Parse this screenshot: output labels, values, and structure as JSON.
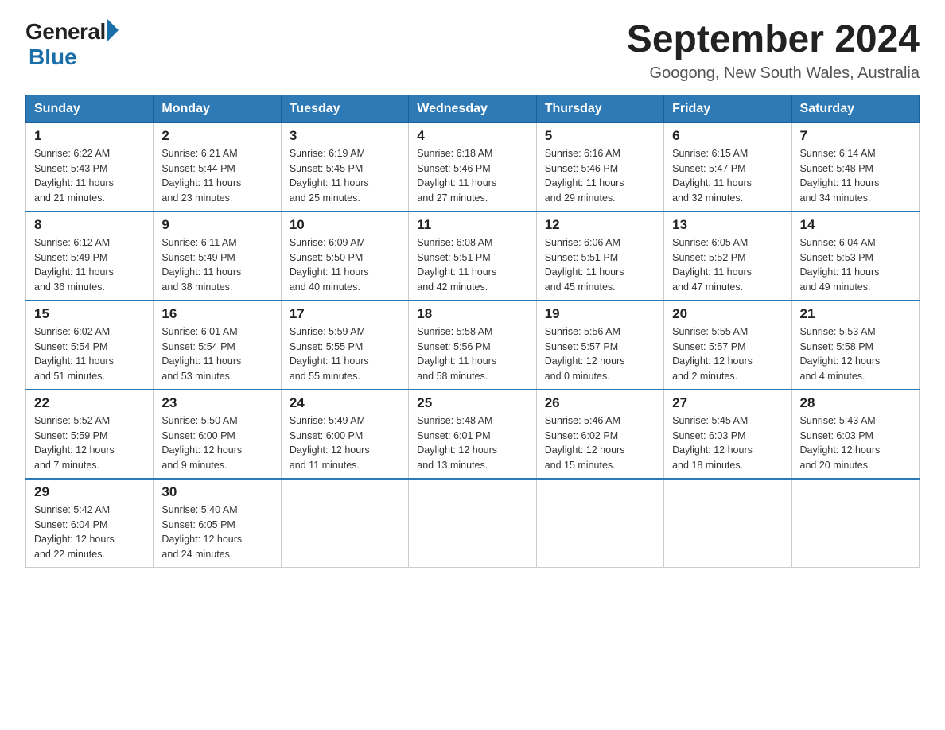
{
  "logo": {
    "general": "General",
    "blue": "Blue"
  },
  "title": "September 2024",
  "subtitle": "Googong, New South Wales, Australia",
  "days_of_week": [
    "Sunday",
    "Monday",
    "Tuesday",
    "Wednesday",
    "Thursday",
    "Friday",
    "Saturday"
  ],
  "weeks": [
    [
      {
        "day": "1",
        "sunrise": "6:22 AM",
        "sunset": "5:43 PM",
        "daylight": "11 hours and 21 minutes."
      },
      {
        "day": "2",
        "sunrise": "6:21 AM",
        "sunset": "5:44 PM",
        "daylight": "11 hours and 23 minutes."
      },
      {
        "day": "3",
        "sunrise": "6:19 AM",
        "sunset": "5:45 PM",
        "daylight": "11 hours and 25 minutes."
      },
      {
        "day": "4",
        "sunrise": "6:18 AM",
        "sunset": "5:46 PM",
        "daylight": "11 hours and 27 minutes."
      },
      {
        "day": "5",
        "sunrise": "6:16 AM",
        "sunset": "5:46 PM",
        "daylight": "11 hours and 29 minutes."
      },
      {
        "day": "6",
        "sunrise": "6:15 AM",
        "sunset": "5:47 PM",
        "daylight": "11 hours and 32 minutes."
      },
      {
        "day": "7",
        "sunrise": "6:14 AM",
        "sunset": "5:48 PM",
        "daylight": "11 hours and 34 minutes."
      }
    ],
    [
      {
        "day": "8",
        "sunrise": "6:12 AM",
        "sunset": "5:49 PM",
        "daylight": "11 hours and 36 minutes."
      },
      {
        "day": "9",
        "sunrise": "6:11 AM",
        "sunset": "5:49 PM",
        "daylight": "11 hours and 38 minutes."
      },
      {
        "day": "10",
        "sunrise": "6:09 AM",
        "sunset": "5:50 PM",
        "daylight": "11 hours and 40 minutes."
      },
      {
        "day": "11",
        "sunrise": "6:08 AM",
        "sunset": "5:51 PM",
        "daylight": "11 hours and 42 minutes."
      },
      {
        "day": "12",
        "sunrise": "6:06 AM",
        "sunset": "5:51 PM",
        "daylight": "11 hours and 45 minutes."
      },
      {
        "day": "13",
        "sunrise": "6:05 AM",
        "sunset": "5:52 PM",
        "daylight": "11 hours and 47 minutes."
      },
      {
        "day": "14",
        "sunrise": "6:04 AM",
        "sunset": "5:53 PM",
        "daylight": "11 hours and 49 minutes."
      }
    ],
    [
      {
        "day": "15",
        "sunrise": "6:02 AM",
        "sunset": "5:54 PM",
        "daylight": "11 hours and 51 minutes."
      },
      {
        "day": "16",
        "sunrise": "6:01 AM",
        "sunset": "5:54 PM",
        "daylight": "11 hours and 53 minutes."
      },
      {
        "day": "17",
        "sunrise": "5:59 AM",
        "sunset": "5:55 PM",
        "daylight": "11 hours and 55 minutes."
      },
      {
        "day": "18",
        "sunrise": "5:58 AM",
        "sunset": "5:56 PM",
        "daylight": "11 hours and 58 minutes."
      },
      {
        "day": "19",
        "sunrise": "5:56 AM",
        "sunset": "5:57 PM",
        "daylight": "12 hours and 0 minutes."
      },
      {
        "day": "20",
        "sunrise": "5:55 AM",
        "sunset": "5:57 PM",
        "daylight": "12 hours and 2 minutes."
      },
      {
        "day": "21",
        "sunrise": "5:53 AM",
        "sunset": "5:58 PM",
        "daylight": "12 hours and 4 minutes."
      }
    ],
    [
      {
        "day": "22",
        "sunrise": "5:52 AM",
        "sunset": "5:59 PM",
        "daylight": "12 hours and 7 minutes."
      },
      {
        "day": "23",
        "sunrise": "5:50 AM",
        "sunset": "6:00 PM",
        "daylight": "12 hours and 9 minutes."
      },
      {
        "day": "24",
        "sunrise": "5:49 AM",
        "sunset": "6:00 PM",
        "daylight": "12 hours and 11 minutes."
      },
      {
        "day": "25",
        "sunrise": "5:48 AM",
        "sunset": "6:01 PM",
        "daylight": "12 hours and 13 minutes."
      },
      {
        "day": "26",
        "sunrise": "5:46 AM",
        "sunset": "6:02 PM",
        "daylight": "12 hours and 15 minutes."
      },
      {
        "day": "27",
        "sunrise": "5:45 AM",
        "sunset": "6:03 PM",
        "daylight": "12 hours and 18 minutes."
      },
      {
        "day": "28",
        "sunrise": "5:43 AM",
        "sunset": "6:03 PM",
        "daylight": "12 hours and 20 minutes."
      }
    ],
    [
      {
        "day": "29",
        "sunrise": "5:42 AM",
        "sunset": "6:04 PM",
        "daylight": "12 hours and 22 minutes."
      },
      {
        "day": "30",
        "sunrise": "5:40 AM",
        "sunset": "6:05 PM",
        "daylight": "12 hours and 24 minutes."
      },
      null,
      null,
      null,
      null,
      null
    ]
  ],
  "labels": {
    "sunrise": "Sunrise:",
    "sunset": "Sunset:",
    "daylight": "Daylight:"
  }
}
